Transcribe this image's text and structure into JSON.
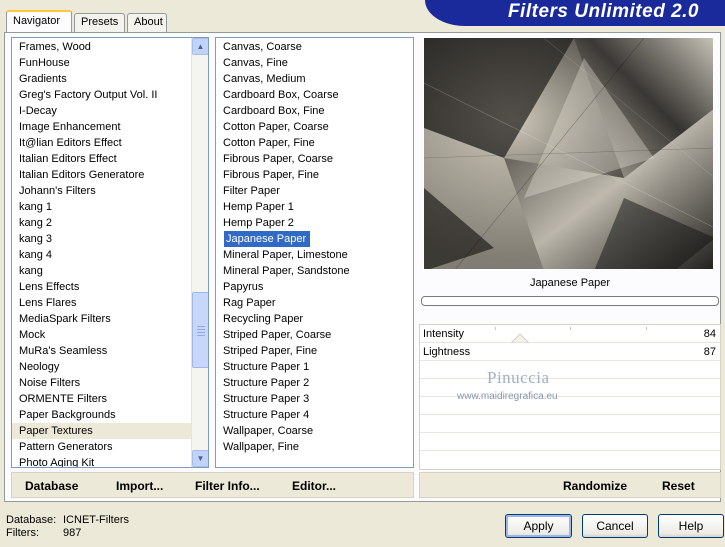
{
  "tabs": [
    {
      "label": "Navigator",
      "active": true
    },
    {
      "label": "Presets",
      "active": false
    },
    {
      "label": "About",
      "active": false
    }
  ],
  "app_title": "Filters Unlimited 2.0",
  "categories": {
    "items": [
      "Frames, Wood",
      "FunHouse",
      "Gradients",
      "Greg's Factory Output Vol. II",
      "I-Decay",
      "Image Enhancement",
      "It@lian Editors Effect",
      "Italian Editors Effect",
      "Italian Editors Generatore",
      "Johann's Filters",
      "kang 1",
      "kang 2",
      "kang 3",
      "kang 4",
      "kang",
      "Lens Effects",
      "Lens Flares",
      "MediaSpark Filters",
      "Mock",
      "MuRa's Seamless",
      "Neology",
      "Noise Filters",
      "ORMENTE Filters",
      "Paper Backgrounds",
      "Paper Textures",
      "Pattern Generators",
      "Photo Aging Kit"
    ],
    "selected": "Paper Textures"
  },
  "filters": {
    "items": [
      "Canvas, Coarse",
      "Canvas, Fine",
      "Canvas, Medium",
      "Cardboard Box, Coarse",
      "Cardboard Box, Fine",
      "Cotton Paper, Coarse",
      "Cotton Paper, Fine",
      "Fibrous Paper, Coarse",
      "Fibrous Paper, Fine",
      "Filter Paper",
      "Hemp Paper 1",
      "Hemp Paper 2",
      "Japanese Paper",
      "Mineral Paper, Limestone",
      "Mineral Paper, Sandstone",
      "Papyrus",
      "Rag Paper",
      "Recycling Paper",
      "Striped Paper, Coarse",
      "Striped Paper, Fine",
      "Structure Paper 1",
      "Structure Paper 2",
      "Structure Paper 3",
      "Structure Paper 4",
      "Wallpaper, Coarse",
      "Wallpaper, Fine"
    ],
    "selected": "Japanese Paper"
  },
  "toolbar": {
    "database": "Database",
    "import": "Import...",
    "filter_info": "Filter Info...",
    "editor": "Editor...",
    "randomize": "Randomize",
    "reset": "Reset"
  },
  "preview": {
    "filter_name": "Japanese Paper"
  },
  "params": [
    {
      "label": "Intensity",
      "value": "84",
      "level": 84
    },
    {
      "label": "Lightness",
      "value": "87",
      "level": 87
    }
  ],
  "watermark": {
    "name": "Pinuccia",
    "site": "www.maidiregrafica.eu"
  },
  "footer": {
    "database_label": "Database:",
    "database_value": "ICNET-Filters",
    "filters_label": "Filters:",
    "filters_value": "987"
  },
  "buttons": {
    "apply": "Apply",
    "cancel": "Cancel",
    "help": "Help"
  },
  "colors": {
    "banner": "#1a2a9a",
    "selection": "#316ac5",
    "tab_highlight": "#ffc83c"
  }
}
